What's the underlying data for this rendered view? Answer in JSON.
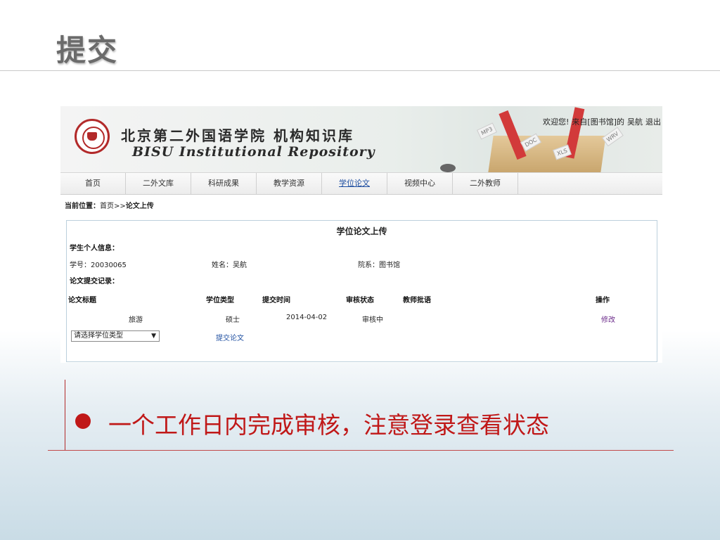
{
  "slide": {
    "title": "提交",
    "callout": "一个工作日内完成审核，注意登录查看状态"
  },
  "site": {
    "name_cn": "北京第二外国语学院 机构知识库",
    "name_en": "BISU Institutional Repository",
    "welcome": {
      "greeting": "欢迎您!",
      "from": "来自[图书馆]的",
      "user": "吴航",
      "logout": "退出"
    },
    "banner_tags": [
      "MP3",
      "DOC",
      "XLS",
      "WRV"
    ]
  },
  "nav": {
    "items": [
      "首页",
      "二外文库",
      "科研成果",
      "教学资源",
      "学位论文",
      "视频中心",
      "二外教师"
    ],
    "active": "学位论文"
  },
  "breadcrumb": {
    "label": "当前位置：",
    "home": "首页",
    "sep": ">>",
    "current": "论文上传"
  },
  "upload": {
    "title": "学位论文上传",
    "student_section": "学生个人信息：",
    "student_id_label": "学号：",
    "student_id": "20030065",
    "name_label": "姓名：",
    "name": "吴航",
    "dept_label": "院系：",
    "dept": "图书馆",
    "records_section": "论文提交记录：",
    "columns": [
      "论文标题",
      "学位类型",
      "提交时间",
      "审核状态",
      "教师批语",
      "操作"
    ],
    "rows": [
      {
        "title": "旅游",
        "degree": "硕士",
        "time": "2014-04-02",
        "status": "审核中",
        "comment": "",
        "action": "修改"
      }
    ],
    "degree_select": "请选择学位类型",
    "submit_label": "提交论文"
  }
}
